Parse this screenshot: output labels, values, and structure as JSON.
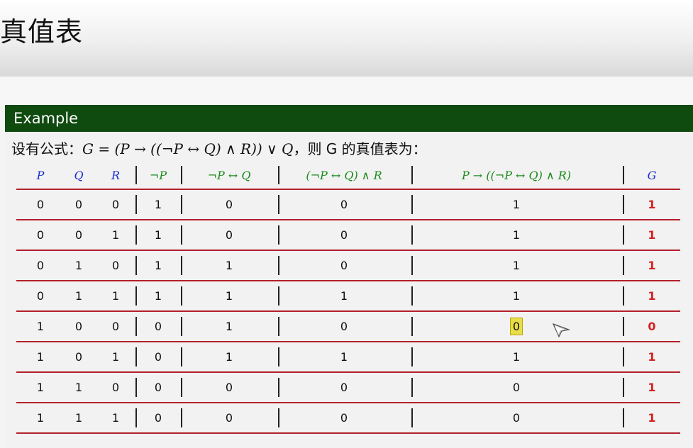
{
  "slide": {
    "title": "真值表",
    "block_title": "Example",
    "formula_prefix": "设有公式：",
    "formula_math": "G = (P → ((¬P ↔ Q) ∧ R)) ∨ Q",
    "formula_suffix": "，则 G 的真值表为："
  },
  "table": {
    "headers": [
      "P",
      "Q",
      "R",
      "¬P",
      "¬P ↔ Q",
      "(¬P ↔ Q) ∧ R",
      "P → ((¬P ↔ Q) ∧ R)",
      "G"
    ],
    "rows": [
      [
        "0",
        "0",
        "0",
        "1",
        "0",
        "0",
        "1",
        "1"
      ],
      [
        "0",
        "0",
        "1",
        "1",
        "0",
        "0",
        "1",
        "1"
      ],
      [
        "0",
        "1",
        "0",
        "1",
        "1",
        "0",
        "1",
        "1"
      ],
      [
        "0",
        "1",
        "1",
        "1",
        "1",
        "1",
        "1",
        "1"
      ],
      [
        "1",
        "0",
        "0",
        "0",
        "1",
        "0",
        "0",
        "0"
      ],
      [
        "1",
        "0",
        "1",
        "0",
        "1",
        "1",
        "1",
        "1"
      ],
      [
        "1",
        "1",
        "0",
        "0",
        "0",
        "0",
        "0",
        "1"
      ],
      [
        "1",
        "1",
        "1",
        "0",
        "0",
        "0",
        "0",
        "1"
      ]
    ]
  },
  "colors": {
    "block_header": "#0f4a0f",
    "atom_header": "#1b2dcc",
    "subformula_header": "#1a8a1a",
    "result": "#d42020",
    "row_rule": "#b3202a",
    "highlight": "#e8de4a"
  },
  "icons": {
    "pointer": "cursor-arrow-icon"
  }
}
